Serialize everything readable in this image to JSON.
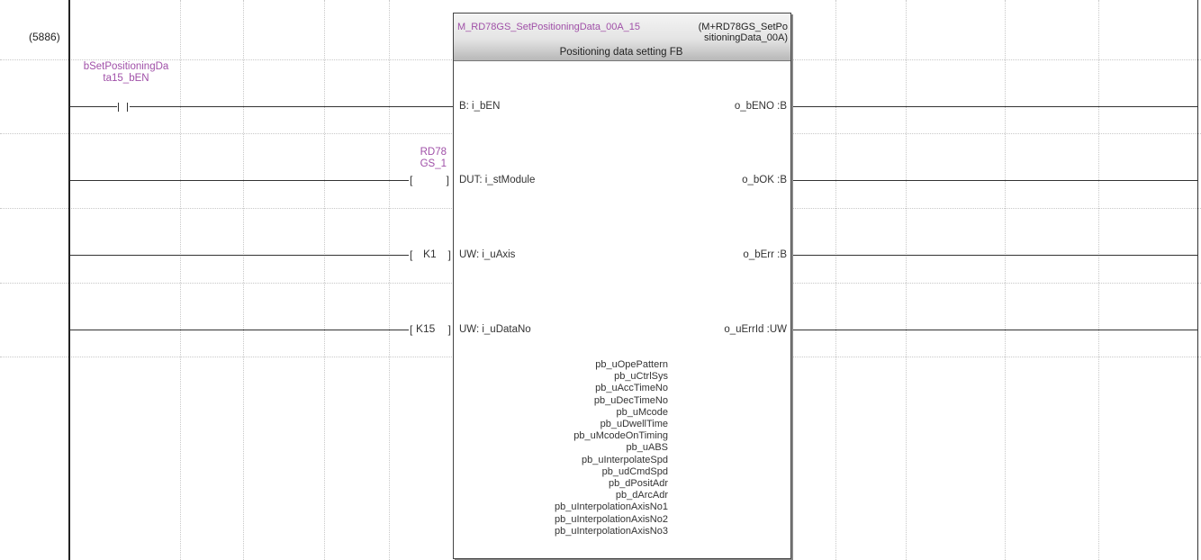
{
  "step_number": "(5886)",
  "contact_label": "bSetPositioningDa\nta15_bEN",
  "fb": {
    "instance_name": "M_RD78GS_SetPositioningData_00A_15",
    "type_name": "(M+RD78GS_SetPo\nsitioningData_00A)",
    "description": "Positioning data setting FB",
    "inputs": [
      {
        "pin": "B: i_bEN"
      },
      {
        "pin": "DUT: i_stModule",
        "operand_label": "RD78\nGS_1"
      },
      {
        "pin": "UW: i_uAxis",
        "operand": "K1"
      },
      {
        "pin": "UW: i_uDataNo",
        "operand": "K15"
      }
    ],
    "outputs": [
      "o_bENO :B",
      "o_bOK :B",
      "o_bErr :B",
      "o_uErrId :UW"
    ],
    "public_vars": [
      "pb_uOpePattern",
      "pb_uCtrlSys",
      "pb_uAccTimeNo",
      "pb_uDecTimeNo",
      "pb_uMcode",
      "pb_uDwellTime",
      "pb_uMcodeOnTiming",
      "pb_uABS",
      "pb_uInterpolateSpd",
      "pb_udCmdSpd",
      "pb_dPositAdr",
      "pb_dArcAdr",
      "pb_uInterpolationAxisNo1",
      "pb_uInterpolationAxisNo2",
      "pb_uInterpolationAxisNo3"
    ]
  },
  "colors": {
    "label": "#a050a8",
    "wire": "#333333",
    "grid": "#c8c8c8"
  }
}
